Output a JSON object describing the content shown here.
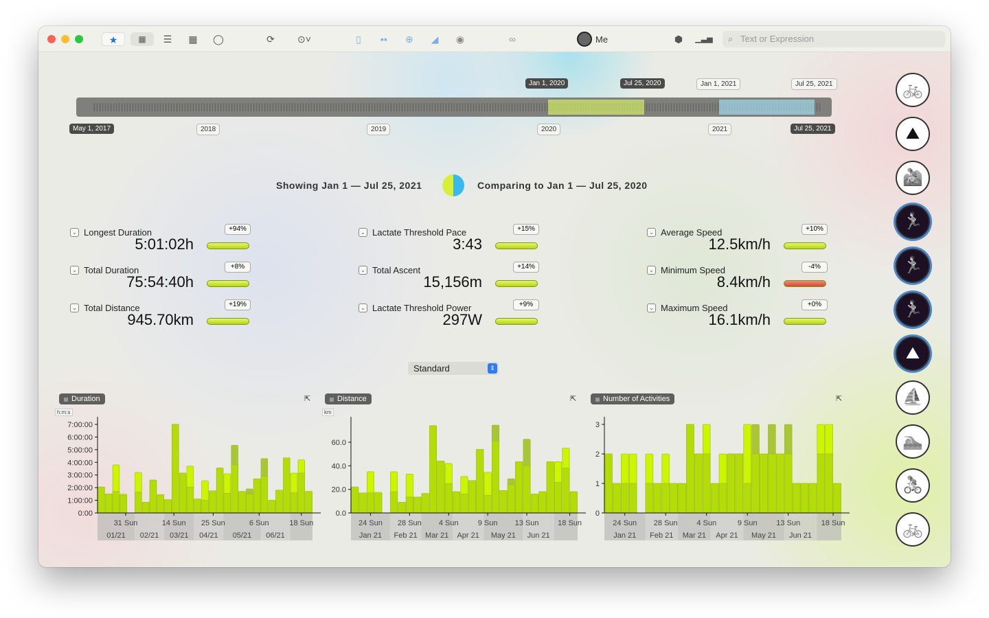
{
  "toolbar": {
    "user": "Me",
    "search_placeholder": "Text or Expression",
    "icons": [
      "star-icon",
      "grid-icon",
      "list-icon",
      "table-icon",
      "ring-icon",
      "refresh-icon",
      "more-icon",
      "sidebar-icon",
      "tiles-icon",
      "globe-icon",
      "area-chart-icon",
      "eye-icon",
      "links-icon",
      "cube-icon",
      "bar-chart-icon"
    ]
  },
  "timeline": {
    "start": "May 1, 2017",
    "years": [
      "2018",
      "2019",
      "2020",
      "2021"
    ],
    "end": "Jul 25, 2021",
    "markers": [
      "Jan 1, 2020",
      "Jul 25, 2020",
      "Jan 1, 2021",
      "Jul 25, 2021"
    ],
    "compare_color": "#d4ec6a",
    "current_color": "#9fd3e6"
  },
  "header": {
    "showing": "Showing Jan 1 — Jul 25, 2021",
    "comparing": "Comparing to Jan 1 — Jul 25, 2020"
  },
  "stats": [
    {
      "label": "Longest Duration",
      "value": "5:01:02h",
      "change": "+94%",
      "trend": "up"
    },
    {
      "label": "Total Duration",
      "value": "75:54:40h",
      "change": "+8%",
      "trend": "up"
    },
    {
      "label": "Total Distance",
      "value": "945.70km",
      "change": "+19%",
      "trend": "up"
    },
    {
      "label": "Lactate Threshold Pace",
      "value": "3:43",
      "change": "+15%",
      "trend": "up"
    },
    {
      "label": "Total Ascent",
      "value": "15,156m",
      "change": "+14%",
      "trend": "up"
    },
    {
      "label": "Lactate Threshold Power",
      "value": "297W",
      "change": "+9%",
      "trend": "up"
    },
    {
      "label": "Average Speed",
      "value": "12.5km/h",
      "change": "+10%",
      "trend": "up"
    },
    {
      "label": "Minimum Speed",
      "value": "8.4km/h",
      "change": "-4%",
      "trend": "down"
    },
    {
      "label": "Maximum Speed",
      "value": "16.1km/h",
      "change": "+0%",
      "trend": "up"
    }
  ],
  "mode_select": "Standard",
  "chart_data": [
    {
      "type": "bar",
      "title": "Duration",
      "unit": "h:m:s",
      "ylim": [
        0,
        7
      ],
      "yticks": [
        "0:00",
        "1:00:00",
        "2:00:00",
        "3:00:00",
        "4:00:00",
        "5:00:00",
        "6:00:00",
        "7:00:00"
      ],
      "xticks": [
        {
          "at": 3.8,
          "label": "31 Sun"
        },
        {
          "at": 10.3,
          "label": "14 Sun"
        },
        {
          "at": 15.6,
          "label": "25 Sun"
        },
        {
          "at": 21.8,
          "label": "6 Sun"
        },
        {
          "at": 27.5,
          "label": "18 Sun"
        }
      ],
      "months": [
        {
          "from": 0,
          "to": 5,
          "label": "01/21"
        },
        {
          "from": 5,
          "to": 9,
          "label": "02/21"
        },
        {
          "from": 9,
          "to": 13,
          "label": "03/21"
        },
        {
          "from": 13,
          "to": 17,
          "label": "04/21"
        },
        {
          "from": 17,
          "to": 22,
          "label": "05/21"
        },
        {
          "from": 22,
          "to": 26,
          "label": "06/21"
        },
        {
          "from": 26,
          "to": 29,
          "label": ""
        }
      ],
      "series": [
        {
          "name": "2021",
          "values": [
            2.05,
            1.5,
            3.8,
            1.5,
            0,
            3.2,
            0.85,
            2.6,
            1.45,
            1.05,
            7.0,
            3.15,
            3.7,
            1.1,
            2.55,
            1.75,
            3.55,
            3.1,
            3.8,
            1.7,
            1.5,
            2.7,
            2.9,
            1.0,
            1.8,
            4.35,
            3.15,
            4.2,
            1.7
          ]
        },
        {
          "name": "2020",
          "values": [
            2.05,
            1.5,
            1.7,
            1.4,
            0,
            1.65,
            0.85,
            2.6,
            1.45,
            1.05,
            7.0,
            3.15,
            2.05,
            1.1,
            1.0,
            1.75,
            3.55,
            1.55,
            5.35,
            1.7,
            1.9,
            2.7,
            4.3,
            1.0,
            1.8,
            4.35,
            1.6,
            3.15,
            1.7
          ]
        }
      ]
    },
    {
      "type": "bar",
      "title": "Distance",
      "unit": "km",
      "ylim": [
        0,
        80
      ],
      "yticks": [
        "0.0",
        "20.0",
        "40.0",
        "60.0"
      ],
      "ytickvals": [
        0,
        20,
        40,
        60
      ],
      "xticks": [
        {
          "at": 2.5,
          "label": "24 Sun"
        },
        {
          "at": 7.5,
          "label": "28 Sun"
        },
        {
          "at": 12.5,
          "label": "4 Sun"
        },
        {
          "at": 17.5,
          "label": "9 Sun"
        },
        {
          "at": 22.5,
          "label": "13 Sun"
        },
        {
          "at": 28,
          "label": "18 Sun"
        }
      ],
      "months": [
        {
          "from": 0,
          "to": 5,
          "label": "Jan 21"
        },
        {
          "from": 5,
          "to": 9,
          "label": "Feb 21"
        },
        {
          "from": 9,
          "to": 13,
          "label": "Mar 21"
        },
        {
          "from": 13,
          "to": 17,
          "label": "Apr 21"
        },
        {
          "from": 17,
          "to": 22,
          "label": "May 21"
        },
        {
          "from": 22,
          "to": 26,
          "label": "Jun 21"
        },
        {
          "from": 26,
          "to": 29,
          "label": ""
        }
      ],
      "series": [
        {
          "name": "2021",
          "values": [
            22,
            17,
            35,
            17.5,
            0,
            35,
            9,
            33,
            13.5,
            16.5,
            74,
            44,
            42,
            18,
            31,
            27.5,
            54,
            34.5,
            61,
            19,
            24,
            43.5,
            40,
            16,
            18,
            43.5,
            43.5,
            55,
            18
          ]
        },
        {
          "name": "2020",
          "values": [
            22,
            17,
            17,
            16.5,
            0,
            18,
            9,
            13.5,
            13.5,
            16.5,
            74,
            44,
            25,
            18,
            16,
            27.5,
            54,
            15,
            74.5,
            19,
            29,
            43.5,
            62.5,
            16,
            18,
            43.5,
            26,
            38,
            18
          ]
        }
      ]
    },
    {
      "type": "bar",
      "title": "Number of Activities",
      "unit": "",
      "ylim": [
        0,
        3.4
      ],
      "yticks": [
        "0",
        "1",
        "2",
        "3"
      ],
      "ytickvals": [
        0,
        1,
        2,
        3
      ],
      "xticks": [
        {
          "at": 2.5,
          "label": "24 Sun"
        },
        {
          "at": 7.5,
          "label": "28 Sun"
        },
        {
          "at": 12.5,
          "label": "4 Sun"
        },
        {
          "at": 17.5,
          "label": "9 Sun"
        },
        {
          "at": 22.5,
          "label": "13 Sun"
        },
        {
          "at": 28,
          "label": "18 Sun"
        }
      ],
      "months": [
        {
          "from": 0,
          "to": 5,
          "label": "Jan 21"
        },
        {
          "from": 5,
          "to": 9,
          "label": "Feb 21"
        },
        {
          "from": 9,
          "to": 13,
          "label": "Mar 21"
        },
        {
          "from": 13,
          "to": 17,
          "label": "Apr 21"
        },
        {
          "from": 17,
          "to": 22,
          "label": "May 21"
        },
        {
          "from": 22,
          "to": 26,
          "label": "Jun 21"
        },
        {
          "from": 26,
          "to": 29,
          "label": ""
        }
      ],
      "series": [
        {
          "name": "2021",
          "values": [
            2,
            1,
            2,
            2,
            0,
            2,
            1,
            2,
            1,
            1,
            3,
            2,
            3,
            1,
            2,
            2,
            2,
            3,
            2,
            2,
            2,
            2,
            2,
            1,
            1,
            1,
            3,
            3,
            1
          ]
        },
        {
          "name": "2020",
          "values": [
            2,
            1,
            1,
            1,
            0,
            1,
            1,
            1,
            1,
            1,
            3,
            2,
            2,
            1,
            1,
            2,
            2,
            1,
            3,
            2,
            3,
            2,
            3,
            1,
            1,
            1,
            2,
            2,
            1
          ]
        }
      ]
    }
  ],
  "sidebar": [
    {
      "icon": "cycling-icon",
      "glyph": "🚲",
      "selected": false
    },
    {
      "icon": "climbing-run-icon",
      "glyph": "⛰",
      "selected": false
    },
    {
      "icon": "mountain-bike-icon",
      "glyph": "🚵",
      "selected": false
    },
    {
      "icon": "running-icon",
      "glyph": "🏃",
      "selected": true
    },
    {
      "icon": "trail-running-icon",
      "glyph": "🏃",
      "selected": true
    },
    {
      "icon": "treadmill-icon",
      "glyph": "🏃",
      "selected": true
    },
    {
      "icon": "uphill-running-icon",
      "glyph": "⛰",
      "selected": true
    },
    {
      "icon": "sailing-icon",
      "glyph": "⛵",
      "selected": false
    },
    {
      "icon": "swimming-icon",
      "glyph": "🏊",
      "selected": false
    },
    {
      "icon": "indoor-cycling-icon",
      "glyph": "🚴",
      "selected": false
    },
    {
      "icon": "road-cycling-icon",
      "glyph": "🚲",
      "selected": false
    }
  ]
}
